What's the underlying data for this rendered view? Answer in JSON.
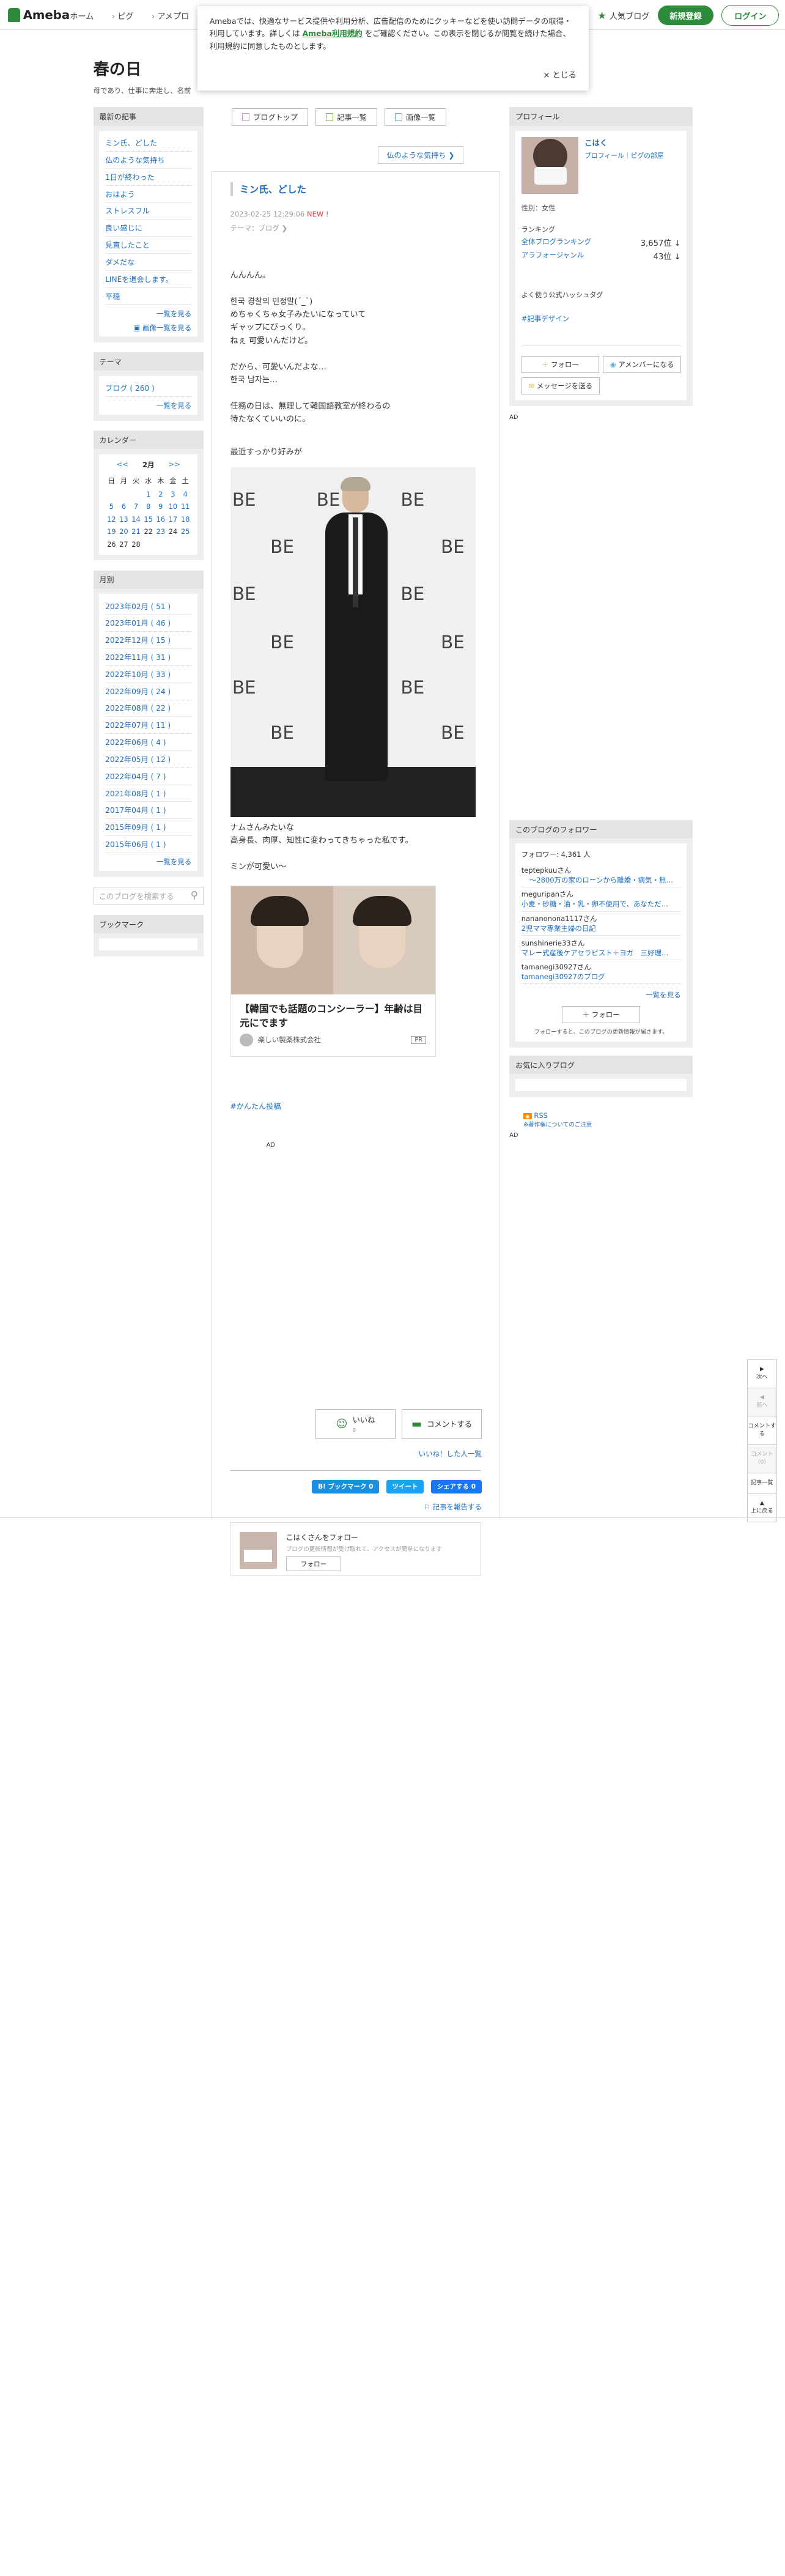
{
  "header": {
    "logo": "Ameba",
    "nav": [
      "ホーム",
      "ピグ",
      "アメプロ"
    ],
    "popular": "人気ブログ",
    "register": "新規登録",
    "login": "ログイン"
  },
  "cookie": {
    "text1": "Amebaでは、快適なサービス提供や利用分析、広告配信のためにクッキーなどを使い訪問データの取得・利用しています。詳しくは ",
    "link": "Ameba利用規約",
    "text2": " をご確認ください。この表示を閉じるか閲覧を続けた場合、利用規約に同意したものとします。",
    "close": "× とじる"
  },
  "blog": {
    "title": "春の日",
    "desc": "母であり、仕事に奔走し、名前"
  },
  "left": {
    "recent_title": "最新の記事",
    "recent": [
      "ミン氏、どした",
      "仏のような気持ち",
      "1日が終わった",
      "おはよう",
      "ストレスフル",
      "良い感じに",
      "見直したこと",
      "ダメだな",
      "LINEを退会します。",
      "平穏"
    ],
    "more": "一覧を見る",
    "img_more": "画像一覧を見る",
    "theme_title": "テーマ",
    "theme": "ブログ ( 260 )",
    "cal_title": "カレンダー",
    "cal_prev": "<<",
    "cal_month": "2月",
    "cal_next": ">>",
    "cal_days": [
      "日",
      "月",
      "火",
      "水",
      "木",
      "金",
      "土"
    ],
    "month_title": "月別",
    "months": [
      "2023年02月 ( 51 )",
      "2023年01月 ( 46 )",
      "2022年12月 ( 15 )",
      "2022年11月 ( 31 )",
      "2022年10月 ( 33 )",
      "2022年09月 ( 24 )",
      "2022年08月 ( 22 )",
      "2022年07月 ( 11 )",
      "2022年06月 ( 4 )",
      "2022年05月 ( 12 )",
      "2022年04月 ( 7 )",
      "2021年08月 ( 1 )",
      "2017年04月 ( 1 )",
      "2015年09月 ( 1 )",
      "2015年06月 ( 1 )"
    ],
    "search_placeholder": "このブログを検索する",
    "bookmark_title": "ブックマーク"
  },
  "main": {
    "tabs": [
      "ブログトップ",
      "記事一覧",
      "画像一覧"
    ],
    "next": "仏のような気持ち ❯",
    "title": "ミン氏、どした",
    "date": "2023-02-25 12:29:06",
    "new": "NEW !",
    "theme": "テーマ：ブログ ❯",
    "body": [
      "んんんん。",
      "한국 경찰의 민정말(ˊ_ˋ)\nめちゃくちゃ女子みたいになっていて\nギャップにびっくり。\nねぇ 可愛いんだけど。",
      "だから、可愛いんだよな…\n한국 남자는…",
      "任務の日は、無理して韓国語教室が終わるの\n待たなくていいのに。",
      "最近すっかり好みが"
    ],
    "photo_text": "BE",
    "after": [
      "ナムさんみたいな\n高身長、肉厚、知性に変わってきちゃった私です。",
      "ミンが可愛い〜"
    ],
    "ad": {
      "title": "【韓国でも話題のコンシーラー】年齢は目元にでます",
      "sponsor": "楽しい製薬株式会社",
      "pr": "PR"
    },
    "hashtag": "#かんたん投稿",
    "ad_label": "AD",
    "like": "いいね",
    "like_count": "0",
    "comment": "コメントする",
    "like_list": "いいね！した人一覧",
    "share": {
      "hatena": "B! ブックマーク 0",
      "tweet": "ツイート",
      "fb": "シェアする 0"
    },
    "report": "記事を報告する",
    "follow": {
      "name": "こはくさんをフォロー",
      "sub": "ブログの更新情報が受け取れて、アクセスが簡単になります",
      "btn": "フォロー"
    }
  },
  "right": {
    "profile_title": "プロフィール",
    "name": "こはく",
    "links": "プロフィール｜ピグの部屋",
    "gender": "性別：女性",
    "rank_title": "ランキング",
    "rank1_label": "全体ブログランキング",
    "rank1": "3,657位 ↓",
    "rank2_label": "アラフォージャンル",
    "rank2": "43位 ↓",
    "hashtag_title": "よく使う公式ハッシュタグ",
    "hashtag": "#記事デザイン",
    "follow_btn": "フォロー",
    "member_btn": "アメンバーになる",
    "msg_btn": "メッセージを送る",
    "ad_label": "AD",
    "followers_title": "このブログのフォロワー",
    "followers_count": "フォロワー: 4,361 人",
    "followers": [
      {
        "user": "teptepkuuさん",
        "blog": "〜2800万の家のローンから離婚・病気・無…"
      },
      {
        "user": "meguripanさん",
        "blog": "小麦・砂糖・油・乳・卵不使用で、あなただ…"
      },
      {
        "user": "nananonona1117さん",
        "blog": "2児ママ専業主婦の日記"
      },
      {
        "user": "sunshinerie33さん",
        "blog": "マレー式産後ケアセラピスト＋ヨガ　三好理…"
      },
      {
        "user": "tamanegi30927さん",
        "blog": "tamanegi30927のブログ"
      }
    ],
    "followers_more": "一覧を見る",
    "follow_btn2": "＋ フォロー",
    "follow_note": "フォローすると、このブログの更新情報が届きます。",
    "fav_title": "お気に入りブログ",
    "rss": "RSS",
    "copyright": "※著作権についてのご注意",
    "ad2": "AD"
  },
  "sidenav": [
    "次へ",
    "前へ",
    "コメントする",
    "コメント(0)",
    "記事一覧",
    "上に戻る"
  ]
}
